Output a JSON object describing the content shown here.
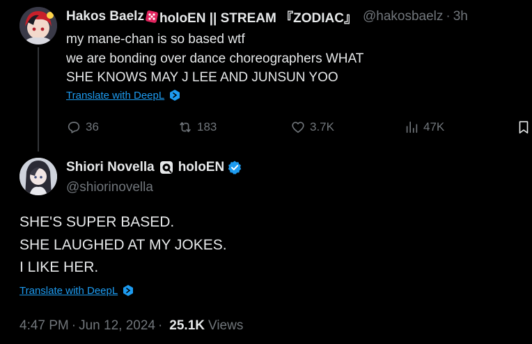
{
  "parent_tweet": {
    "display_name_part1": "Hakos Baelz",
    "display_name_part2": "holoEN || STREAM 『ZODIAC』",
    "handle": "@hakosbaelz",
    "separator": "·",
    "time_ago": "3h",
    "text_lines": [
      "my mane-chan is so based wtf",
      "we are bonding over dance choreographers WHAT",
      "SHE KNOWS MAY J LEE AND JUNSUN YOO"
    ],
    "translate_label": "Translate with DeepL",
    "actions": {
      "replies": "36",
      "retweets": "183",
      "likes": "3.7K",
      "views": "47K"
    }
  },
  "reply_tweet": {
    "display_name_part1": "Shiori Novella",
    "display_name_part2": "holoEN",
    "handle": "@shiorinovella",
    "text_lines": [
      "SHE'S SUPER BASED.",
      "SHE LAUGHED AT MY JOKES.",
      "I LIKE HER."
    ],
    "translate_label": "Translate with DeepL",
    "time": "4:47 PM",
    "separator": "·",
    "date": "Jun 12, 2024",
    "views_count": "25.1K",
    "views_label": "Views"
  },
  "colors": {
    "background": "#000000",
    "text_primary": "#e7e9ea",
    "text_secondary": "#71767b",
    "link": "#1d9bf0",
    "verified": "#1d9bf0",
    "thread_line": "#333639",
    "dice_red": "#e0245e"
  },
  "icons": {
    "dice": "dice-icon",
    "deepl": "deepl-icon",
    "reply": "reply-icon",
    "retweet": "retweet-icon",
    "like": "heart-icon",
    "views": "views-chart-icon",
    "bookmark": "bookmark-icon",
    "eye": "eye-icon",
    "verified": "verified-badge-icon"
  }
}
